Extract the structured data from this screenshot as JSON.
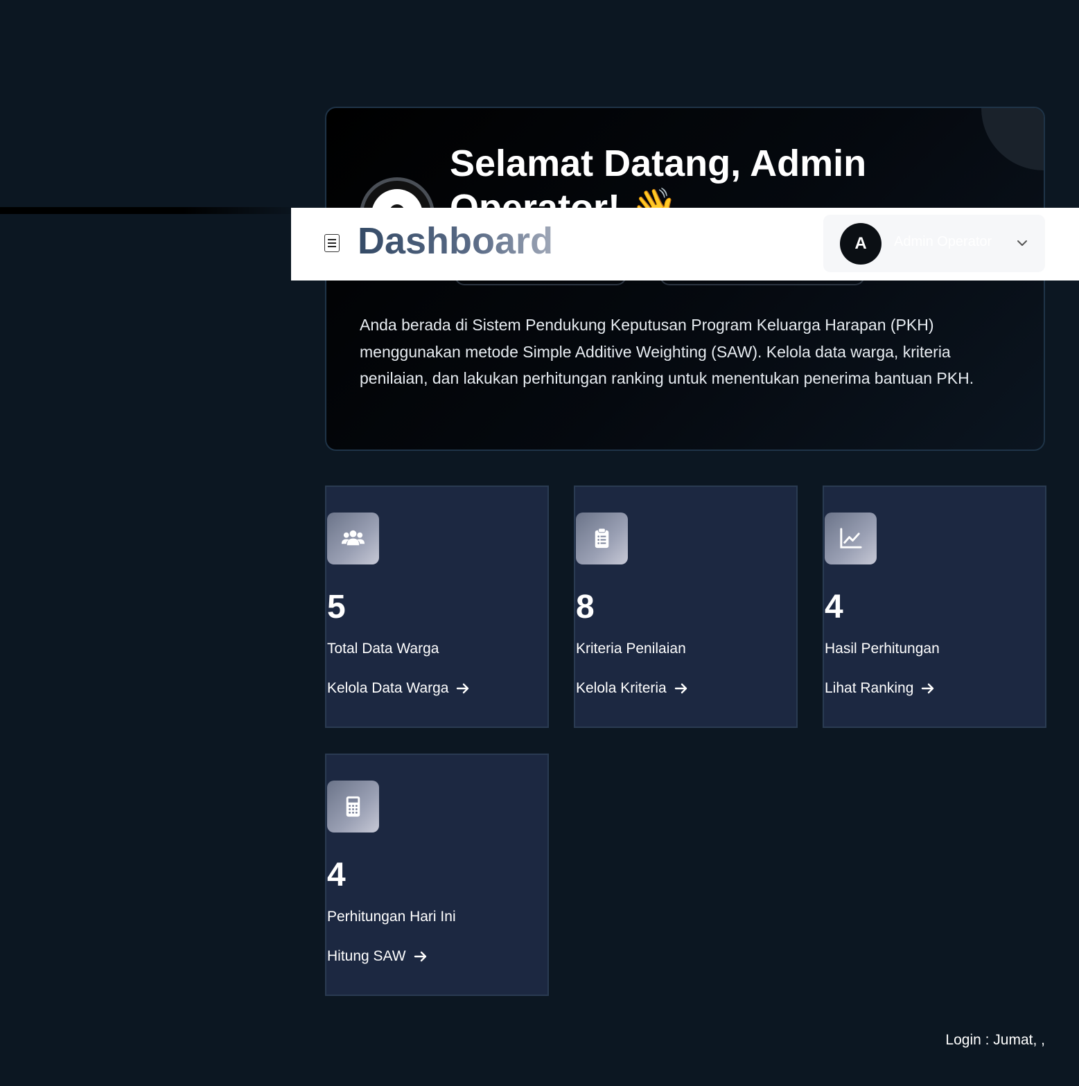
{
  "header": {
    "title": "Dashboard",
    "menu_icon": "hamburger-menu-icon",
    "user": {
      "initial": "A",
      "name": "Admin Operator",
      "dropdown_icon": "chevron-down-icon"
    }
  },
  "hero": {
    "greeting": "Selamat Datang, Admin Operator! 👋",
    "avatar_icon": "user-circle-icon",
    "description": "Anda berada di Sistem Pendukung Keputusan Program Keluarga Harapan (PKH) menggunakan metode Simple Additive Weighting (SAW). Kelola data warga, kriteria penilaian, dan lakukan perhitungan ranking untuk menentukan penerima bantuan PKH."
  },
  "stats": [
    {
      "icon": "users-icon",
      "value": "5",
      "label": "Total Data Warga",
      "link": "Kelola Data Warga"
    },
    {
      "icon": "clipboard-list-icon",
      "value": "8",
      "label": "Kriteria Penilaian",
      "link": "Kelola Kriteria"
    },
    {
      "icon": "chart-line-icon",
      "value": "4",
      "label": "Hasil Perhitungan",
      "link": "Lihat Ranking"
    },
    {
      "icon": "calculator-icon",
      "value": "4",
      "label": "Perhitungan Hari Ini",
      "link": "Hitung SAW"
    }
  ],
  "footer": {
    "login_text": "Login : Jumat, ,"
  },
  "colors": {
    "background": "#0c1722",
    "card": "#1c2841",
    "card_border": "#2a3b52",
    "header_bg": "#ffffff",
    "title_gradient_start": "#344a66"
  }
}
